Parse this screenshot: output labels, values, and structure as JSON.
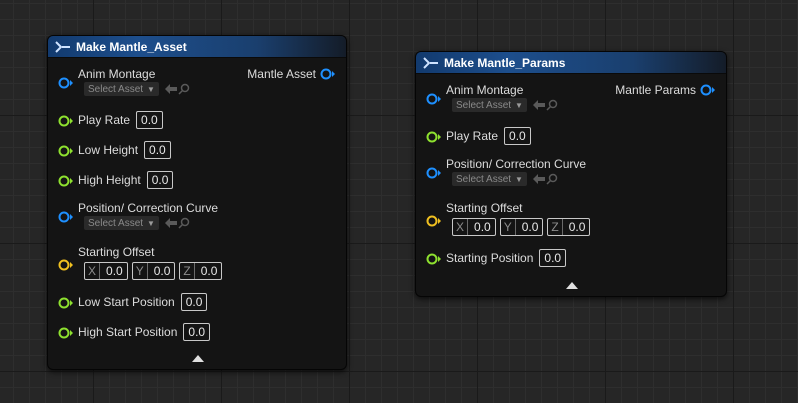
{
  "colors": {
    "struct_pin": "#1e90ff",
    "float_pin": "#8ee12f",
    "vector_pin": "#f0c020",
    "header_blue": "#1d4e8c"
  },
  "node1": {
    "title": "Make Mantle_Asset",
    "output_label": "Mantle Asset",
    "anim_montage": {
      "label": "Anim Montage",
      "select": "Select Asset"
    },
    "play_rate": {
      "label": "Play Rate",
      "value": "0.0"
    },
    "low_height": {
      "label": "Low Height",
      "value": "0.0"
    },
    "high_height": {
      "label": "High Height",
      "value": "0.0"
    },
    "curve": {
      "label": "Position/ Correction Curve",
      "select": "Select Asset"
    },
    "starting_offset": {
      "label": "Starting Offset",
      "x_label": "X",
      "x": "0.0",
      "y_label": "Y",
      "y": "0.0",
      "z_label": "Z",
      "z": "0.0"
    },
    "low_start": {
      "label": "Low Start Position",
      "value": "0.0"
    },
    "high_start": {
      "label": "High Start Position",
      "value": "0.0"
    }
  },
  "node2": {
    "title": "Make Mantle_Params",
    "output_label": "Mantle Params",
    "anim_montage": {
      "label": "Anim Montage",
      "select": "Select Asset"
    },
    "play_rate": {
      "label": "Play Rate",
      "value": "0.0"
    },
    "curve": {
      "label": "Position/ Correction Curve",
      "select": "Select Asset"
    },
    "starting_offset": {
      "label": "Starting Offset",
      "x_label": "X",
      "x": "0.0",
      "y_label": "Y",
      "y": "0.0",
      "z_label": "Z",
      "z": "0.0"
    },
    "starting_position": {
      "label": "Starting Position",
      "value": "0.0"
    }
  }
}
